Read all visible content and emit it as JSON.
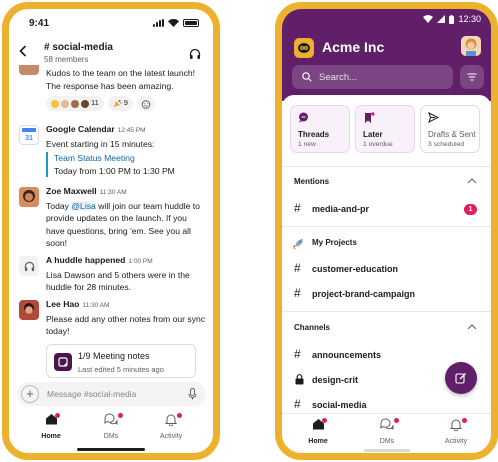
{
  "colors": {
    "frame": "#ecb22e",
    "aubergine": "#611f69",
    "mention_badge": "#e01e5a",
    "link": "#1264a3",
    "calendar_bar": "#1d9bd1"
  },
  "phone1": {
    "status_time": "9:41",
    "channel": {
      "title": "# social-media",
      "members": "58 members",
      "back_icon": "chevron-left-icon",
      "huddle_icon": "headphones-icon"
    },
    "messages": {
      "kudos": {
        "text": "Kudos to the team on the latest launch! The response has been amazing.",
        "reactions": [
          {
            "emoji": "clapping-hands",
            "count": "11"
          },
          {
            "emoji": "party-popper",
            "count": "9"
          }
        ]
      },
      "calendar": {
        "sender": "Google Calendar",
        "time": "12:45 PM",
        "intro": "Event starting in 15 minutes:",
        "event_title": "Team Status Meeting",
        "event_time": "Today from 1:00 PM to 1:30 PM"
      },
      "zoe": {
        "sender": "Zoe Maxwell",
        "time": "11:30 AM",
        "text_before": "Today ",
        "mention": "@Lisa",
        "text_after": " will join our team huddle to provide updates on the launch. If you have questions, bring 'em. See you all soon!"
      },
      "huddle": {
        "sender": "A huddle happened",
        "time": "1:00 PM",
        "text": "Lisa Dawson and 5 others were in the huddle for 28 minutes."
      },
      "lee": {
        "sender": "Lee Hao",
        "time": "11:30 AM",
        "text": "Please add any other notes from our sync today!",
        "note_title": "1/9 Meeting notes",
        "note_sub": "Last edited 5 minutes ago"
      }
    },
    "composer": {
      "placeholder": "Message #social-media"
    },
    "tabs": [
      {
        "label": "Home",
        "icon": "home-icon"
      },
      {
        "label": "DMs",
        "icon": "dms-icon"
      },
      {
        "label": "Activity",
        "icon": "bell-icon"
      }
    ]
  },
  "phone2": {
    "status_time": "12:30",
    "workspace": "Acme Inc",
    "search_placeholder": "Search...",
    "cards": [
      {
        "label": "Threads",
        "sub": "1 new",
        "icon": "threads-icon"
      },
      {
        "label": "Later",
        "sub": "1 overdue",
        "icon": "bookmark-icon"
      },
      {
        "label": "Drafts & Sent",
        "sub": "3 scheduled",
        "icon": "send-icon"
      }
    ],
    "mentions": {
      "title": "Mentions",
      "items": [
        {
          "label": "media-and-pr",
          "badge": "1"
        }
      ]
    },
    "projects": {
      "title": "My Projects",
      "items": [
        {
          "label": "customer-education"
        },
        {
          "label": "project-brand-campaign"
        }
      ]
    },
    "channels": {
      "title": "Channels",
      "items": [
        {
          "label": "announcements",
          "icon": "hash-icon"
        },
        {
          "label": "design-crit",
          "icon": "lock-icon"
        },
        {
          "label": "social-media",
          "icon": "hash-icon"
        }
      ]
    },
    "tabs": [
      {
        "label": "Home",
        "icon": "home-icon"
      },
      {
        "label": "DMs",
        "icon": "dms-icon"
      },
      {
        "label": "Activity",
        "icon": "bell-icon"
      }
    ]
  }
}
